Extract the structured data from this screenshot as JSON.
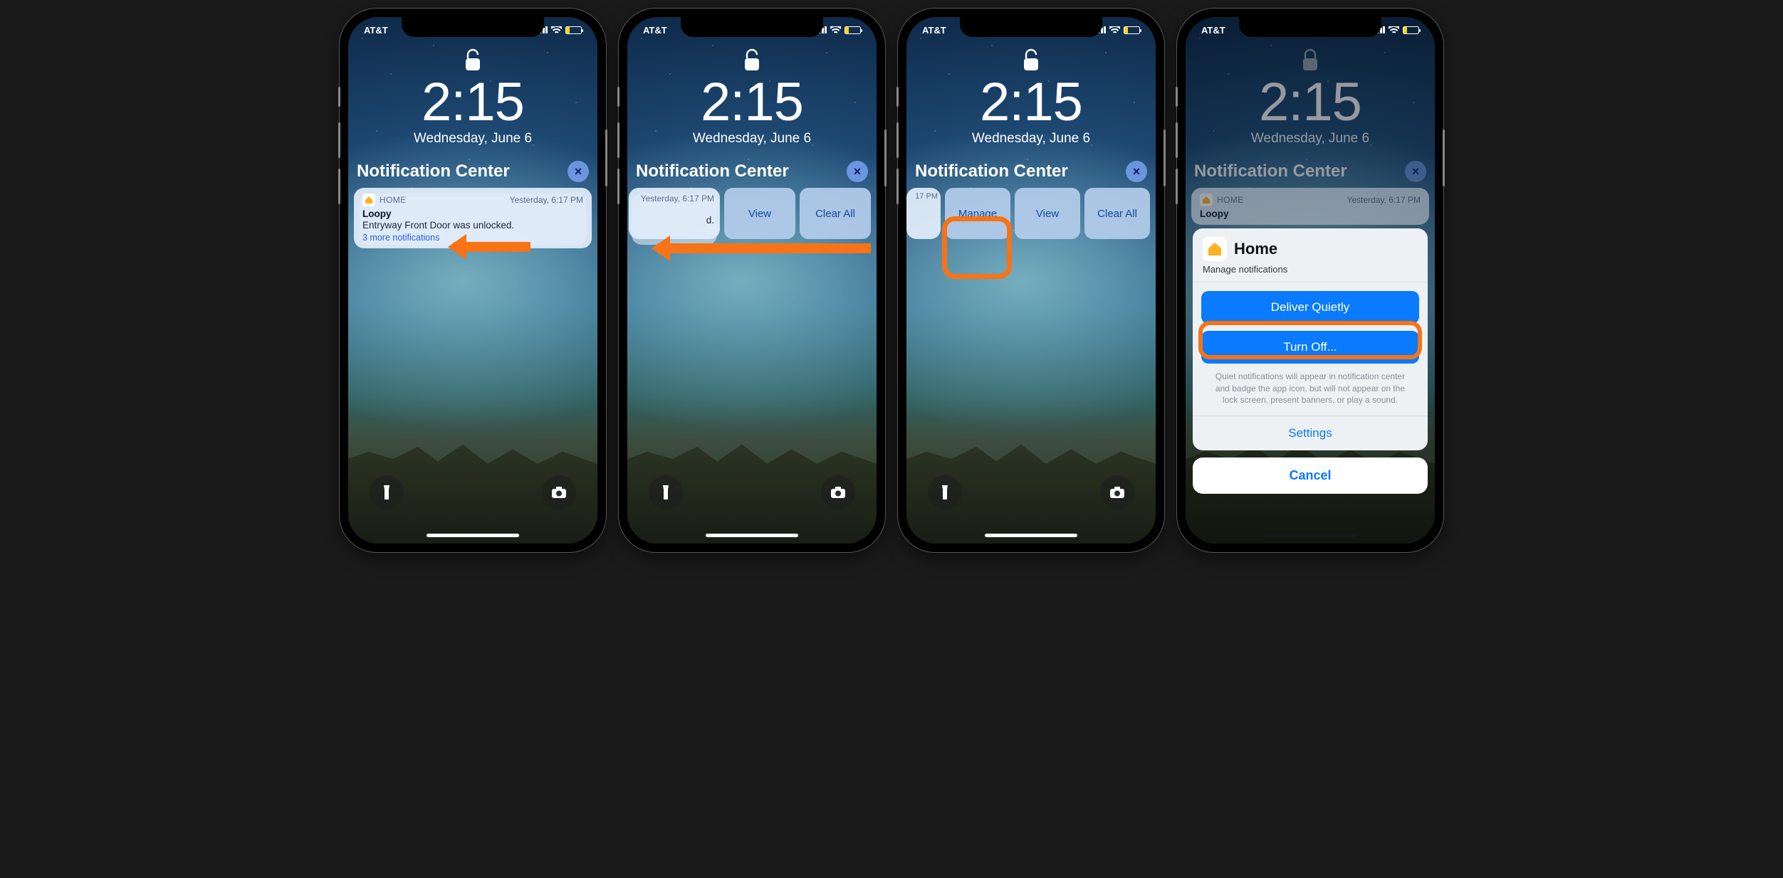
{
  "status": {
    "carrier": "AT&T"
  },
  "lock": {
    "time": "2:15",
    "date": "Wednesday, June 6"
  },
  "nc": {
    "title": "Notification Center"
  },
  "notif": {
    "app": "HOME",
    "timestamp": "Yesterday, 6:17 PM",
    "title": "Loopy",
    "body": "Entryway Front Door was unlocked.",
    "more": "3 more notifications"
  },
  "swipe2": {
    "timestamp": "Yesterday, 6:17 PM",
    "body_fragment": "d.",
    "view": "View",
    "clear": "Clear All"
  },
  "swipe3": {
    "ts_fragment": "17 PM",
    "manage": "Manage",
    "view": "View",
    "clear": "Clear All"
  },
  "sheet": {
    "app": "Home",
    "subtitle": "Manage notifications",
    "deliver": "Deliver Quietly",
    "turnoff": "Turn Off...",
    "note": "Quiet notifications will appear in notification center and badge the app icon, but will not appear on the lock screen, present banners, or play a sound.",
    "settings": "Settings",
    "cancel": "Cancel"
  }
}
